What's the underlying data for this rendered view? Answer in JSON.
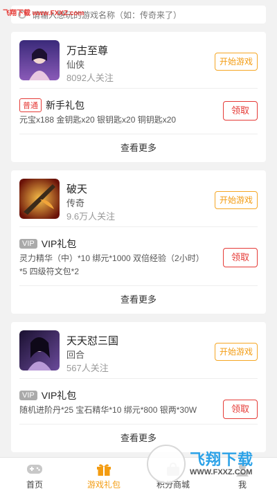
{
  "watermark": {
    "top_text": "飞翔下载 www.FXXZ.com",
    "logo_text": "飞翔下载",
    "logo_url": "WWW.FXXZ.COM"
  },
  "search": {
    "placeholder": "请输入想玩的游戏名称（如：传奇来了）"
  },
  "common": {
    "start_label": "开始游戏",
    "get_label": "领取",
    "more_label": "查看更多"
  },
  "cards": [
    {
      "game": {
        "name": "万古至尊",
        "category": "仙侠",
        "followers": "8092人关注",
        "icon_colors": [
          "#5b3fa0",
          "#e9c7e0"
        ]
      },
      "gift": {
        "badge": "普通",
        "badge_type": "normal",
        "name": "新手礼包",
        "desc": "元宝x188 金钥匙x20 银钥匙x20 铜钥匙x20"
      }
    },
    {
      "game": {
        "name": "破天",
        "category": "传奇",
        "followers": "9.6万人关注",
        "icon_colors": [
          "#7a1a0a",
          "#f2a53a"
        ]
      },
      "gift": {
        "badge": "VIP",
        "badge_type": "vip",
        "name": "VIP礼包",
        "desc": "灵力精华（中）*10 绑元*1000 双倍经验（2小时）*5 四级符文包*2"
      }
    },
    {
      "game": {
        "name": "天天怼三国",
        "category": "回合",
        "followers": "567人关注",
        "icon_colors": [
          "#2a1a40",
          "#b99ad8"
        ]
      },
      "gift": {
        "badge": "VIP",
        "badge_type": "vip",
        "name": "VIP礼包",
        "desc": "随机进阶丹*25 宝石精华*10 绑元*800 银两*30W"
      }
    }
  ],
  "tabs": [
    {
      "label": "首页",
      "icon": "gamepad-icon",
      "active": false
    },
    {
      "label": "游戏礼包",
      "icon": "gift-icon",
      "active": true
    },
    {
      "label": "积分商城",
      "icon": "shop-icon",
      "active": false
    },
    {
      "label": "我",
      "icon": "user-icon",
      "active": false
    }
  ],
  "colors": {
    "accent": "#f39c12",
    "danger": "#e53935"
  }
}
